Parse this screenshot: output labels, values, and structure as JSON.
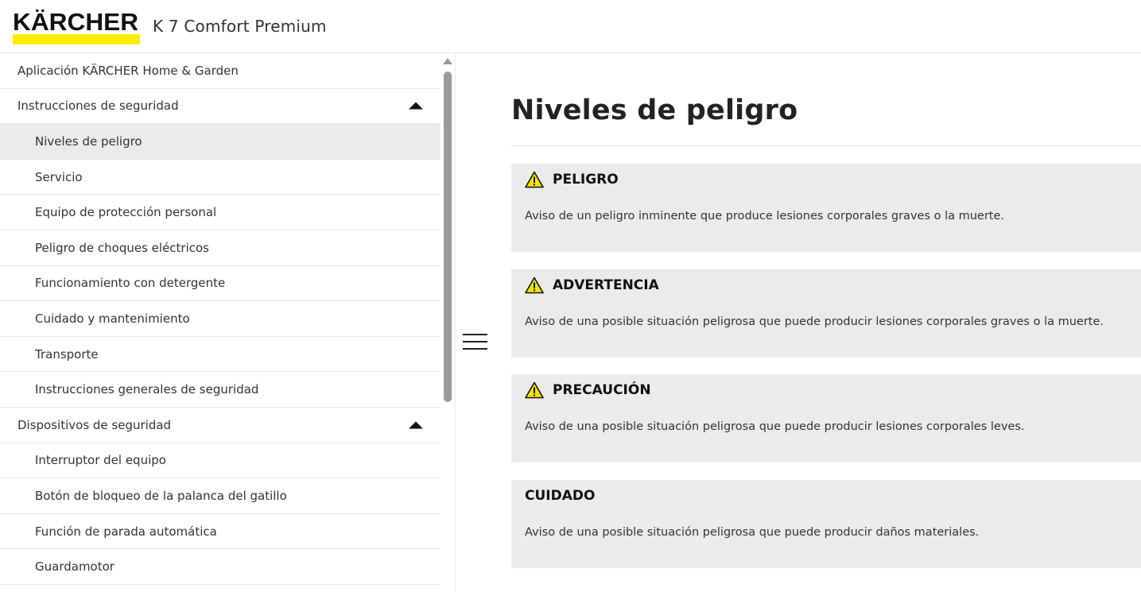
{
  "header": {
    "logo_text": "KÄRCHER",
    "product_title": "K 7 Comfort Premium"
  },
  "sidebar": {
    "items": [
      {
        "label": "Aplicación KÄRCHER Home & Garden",
        "level": 1
      },
      {
        "label": "Instrucciones de seguridad",
        "level": 1,
        "expanded": true
      },
      {
        "label": "Niveles de peligro",
        "level": 2,
        "active": true
      },
      {
        "label": "Servicio",
        "level": 2
      },
      {
        "label": "Equipo de protección personal",
        "level": 2
      },
      {
        "label": "Peligro de choques eléctricos",
        "level": 2
      },
      {
        "label": "Funcionamiento con detergente",
        "level": 2
      },
      {
        "label": "Cuidado y mantenimiento",
        "level": 2
      },
      {
        "label": "Transporte",
        "level": 2
      },
      {
        "label": "Instrucciones generales de seguridad",
        "level": 2
      },
      {
        "label": "Dispositivos de seguridad",
        "level": 1,
        "expanded": true
      },
      {
        "label": "Interruptor del equipo",
        "level": 2
      },
      {
        "label": "Botón de bloqueo de la palanca del gatillo",
        "level": 2
      },
      {
        "label": "Función de parada automática",
        "level": 2
      },
      {
        "label": "Guardamotor",
        "level": 2
      }
    ]
  },
  "main": {
    "title": "Niveles de peligro",
    "notices": [
      {
        "label": "PELIGRO",
        "icon": "warning-icon",
        "text": "Aviso de un peligro inminente que produce lesiones corporales graves o la muerte."
      },
      {
        "label": "ADVERTENCIA",
        "icon": "warning-icon",
        "text": "Aviso de una posible situación peligrosa que puede producir lesiones corporales graves o la muerte."
      },
      {
        "label": "PRECAUCIÓN",
        "icon": "warning-icon",
        "text": "Aviso de una posible situación peligrosa que puede producir lesiones corporales leves."
      },
      {
        "label": "CUIDADO",
        "icon": null,
        "text": "Aviso de una posible situación peligrosa que puede producir daños materiales."
      }
    ]
  },
  "colors": {
    "brand_yellow": "#ffed00",
    "active_row": "#ebebeb",
    "notice_bg": "#ebebeb",
    "warning_yellow": "#f5e400"
  }
}
